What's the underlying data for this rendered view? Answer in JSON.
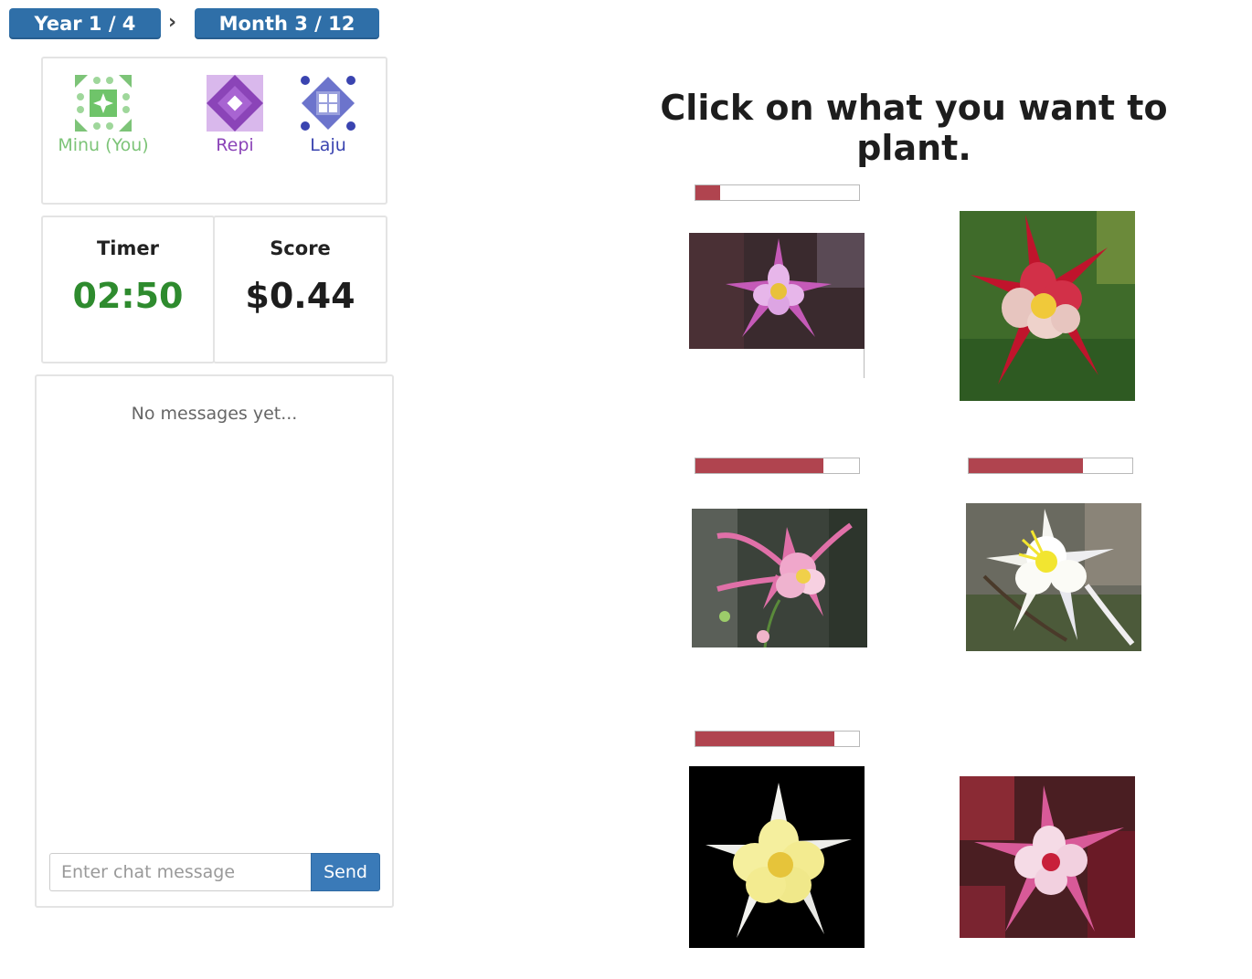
{
  "breadcrumb": {
    "year": "Year 1 / 4",
    "month": "Month 3 / 12",
    "separator": "›"
  },
  "players": [
    {
      "name": "Minu (You)",
      "color": "#7dc478",
      "icon": "green-quilt-icon"
    },
    {
      "name": "Repi",
      "color": "#8b44b8",
      "icon": "purple-diamond-icon"
    },
    {
      "name": "Laju",
      "color": "#3a44b0",
      "icon": "blue-window-icon"
    }
  ],
  "timer": {
    "label": "Timer",
    "value": "02:50",
    "color": "#2e8b2e"
  },
  "score": {
    "label": "Score",
    "value": "$0.44"
  },
  "chat": {
    "empty_text": "No messages yet...",
    "placeholder": "Enter chat message",
    "send_label": "Send"
  },
  "prompt": "Click on what you want to plant.",
  "flowers": [
    {
      "name": "pink-purple-columbine",
      "progress": 0.15
    },
    {
      "name": "red-columbine",
      "progress": null
    },
    {
      "name": "pink-columbine",
      "progress": 0.78
    },
    {
      "name": "white-columbine",
      "progress": 0.7
    },
    {
      "name": "yellow-columbine",
      "progress": 0.85
    },
    {
      "name": "pink-white-columbine",
      "progress": null
    }
  ],
  "colors": {
    "accent": "#2f6fa8",
    "progress_fill": "#b0444f"
  }
}
